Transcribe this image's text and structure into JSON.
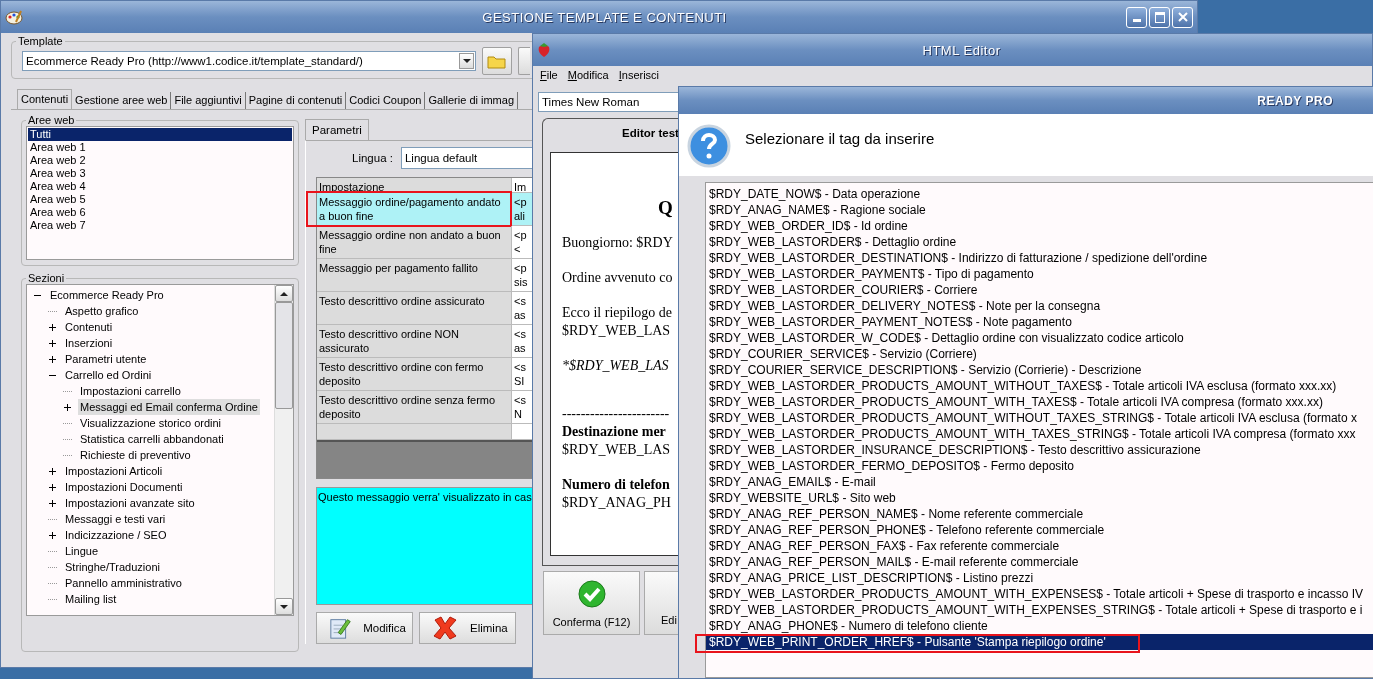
{
  "main_window": {
    "title": "GESTIONE TEMPLATE E CONTENUTI",
    "template": {
      "label": "Template",
      "value": "Ecommerce Ready Pro (http://www1.codice.it/template_standard/)"
    },
    "tabs": [
      {
        "label": "Contenuti",
        "selected": true
      },
      {
        "label": "Gestione aree web",
        "selected": false
      },
      {
        "label": "File aggiuntivi",
        "selected": false
      },
      {
        "label": "Pagine di contenuti",
        "selected": false
      },
      {
        "label": "Codici Coupon",
        "selected": false
      },
      {
        "label": "Gallerie di immag",
        "selected": false
      }
    ],
    "web_areas": {
      "label": "Aree web",
      "items": [
        {
          "label": "Tutti",
          "selected": true
        },
        {
          "label": "Area web 1",
          "selected": false
        },
        {
          "label": "Area web 2",
          "selected": false
        },
        {
          "label": "Area web 3",
          "selected": false
        },
        {
          "label": "Area web 4",
          "selected": false
        },
        {
          "label": "Area web 5",
          "selected": false
        },
        {
          "label": "Area web 6",
          "selected": false
        },
        {
          "label": "Area web 7",
          "selected": false
        }
      ]
    },
    "sections": {
      "label": "Sezioni",
      "tree": [
        {
          "label": "Ecommerce Ready Pro",
          "expanded": true,
          "selected": false,
          "children": [
            {
              "label": "Aspetto grafico",
              "selected": false
            },
            {
              "label": "Contenuti",
              "expanded": false,
              "selected": false
            },
            {
              "label": "Inserzioni",
              "expanded": false,
              "selected": false
            },
            {
              "label": "Parametri utente",
              "expanded": false,
              "selected": false
            },
            {
              "label": "Carrello ed Ordini",
              "expanded": true,
              "selected": false,
              "children": [
                {
                  "label": "Impostazioni carrello",
                  "selected": false
                },
                {
                  "label": "Messaggi ed Email conferma Ordine",
                  "expanded": false,
                  "selected": true
                },
                {
                  "label": "Visualizzazione storico ordini",
                  "selected": false
                },
                {
                  "label": "Statistica carrelli abbandonati",
                  "selected": false
                },
                {
                  "label": "Richieste di preventivo",
                  "selected": false
                }
              ]
            },
            {
              "label": "Impostazioni Articoli",
              "expanded": false,
              "selected": false
            },
            {
              "label": "Impostazioni Documenti",
              "expanded": false,
              "selected": false
            },
            {
              "label": "Impostazioni avanzate sito",
              "expanded": false,
              "selected": false
            },
            {
              "label": "Messaggi e testi vari",
              "selected": false
            },
            {
              "label": "Indicizzazione / SEO",
              "expanded": false,
              "selected": false
            },
            {
              "label": "Lingue",
              "selected": false
            },
            {
              "label": "Stringhe/Traduzioni",
              "selected": false
            },
            {
              "label": "Pannello amministrativo",
              "selected": false
            },
            {
              "label": "Mailing list",
              "selected": false
            }
          ]
        }
      ]
    },
    "parameters": {
      "tab": "Parametri",
      "language_label": "Lingua :",
      "language_value": "Lingua default",
      "columns": [
        "Impostazione",
        "Im"
      ],
      "rows": [
        {
          "setting": "Messaggio ordine/pagamento andato a buon fine",
          "value": [
            "<p",
            "ali"
          ],
          "selected": true
        },
        {
          "setting": "Messaggio ordine non andato a buon fine",
          "value": [
            "<p",
            "<"
          ],
          "selected": false
        },
        {
          "setting": "Messaggio per pagamento fallito",
          "value": [
            "<p",
            "sis"
          ],
          "selected": false
        },
        {
          "setting": "Testo descrittivo ordine assicurato",
          "value": [
            "<s",
            "as"
          ],
          "selected": false
        },
        {
          "setting": "Testo descrittivo ordine NON assicurato",
          "value": [
            "<s",
            "as"
          ],
          "selected": false
        },
        {
          "setting": "Testo descrittivo ordine con fermo deposito",
          "value": [
            "<s",
            "SI"
          ],
          "selected": false
        },
        {
          "setting": "Testo descrittivo ordine senza fermo deposito",
          "value": [
            "<s",
            "N"
          ],
          "selected": false
        }
      ],
      "description": "Questo messaggio verra' visualizzato in cas",
      "buttons": [
        {
          "label": "Modifica",
          "kind": "edit"
        },
        {
          "label": "Elimina",
          "kind": "delete"
        }
      ]
    }
  },
  "html_editor": {
    "title": "HTML Editor",
    "menu": [
      "File",
      "Modifica",
      "Inserisci"
    ],
    "font": "Times New Roman",
    "panel_title": "Editor test",
    "document": [
      [
        {
          "kind": "heading",
          "text": "Q"
        }
      ],
      [
        {
          "kind": "plain",
          "text": "Buongiorno: $RDY"
        }
      ],
      [
        {
          "kind": "plain",
          "text": "Ordine avvenuto co"
        }
      ],
      [
        {
          "kind": "plain",
          "text": "Ecco il riepilogo de"
        },
        {
          "kind": "plain",
          "text": "$RDY_WEB_LAS"
        }
      ],
      [
        {
          "kind": "italic",
          "text": "*$RDY_WEB_LAS"
        }
      ],
      [
        {
          "kind": "rule",
          "text": "-----------------------"
        },
        {
          "kind": "bold",
          "text": "Destinazione mer"
        },
        {
          "kind": "plain",
          "text": "$RDY_WEB_LAS"
        }
      ],
      [
        {
          "kind": "bold",
          "text": "Numero di telefon"
        },
        {
          "kind": "plain",
          "text": "$RDY_ANAG_PH"
        }
      ]
    ],
    "buttons": [
      {
        "label": "Conferma (F12)",
        "kind": "confirm"
      },
      {
        "label": "Edi",
        "kind": "plain"
      }
    ]
  },
  "dialog": {
    "title": "READY PRO",
    "prompt": "Selezionare il tag da inserire",
    "tags": [
      {
        "text": "$RDY_DATE_NOW$ - Data operazione",
        "selected": false
      },
      {
        "text": "$RDY_ANAG_NAME$ - Ragione sociale",
        "selected": false
      },
      {
        "text": "$RDY_WEB_ORDER_ID$ - Id ordine",
        "selected": false
      },
      {
        "text": "$RDY_WEB_LASTORDER$ - Dettaglio ordine",
        "selected": false
      },
      {
        "text": "$RDY_WEB_LASTORDER_DESTINATION$ - Indirizzo di fatturazione / spedizione dell'ordine",
        "selected": false
      },
      {
        "text": "$RDY_WEB_LASTORDER_PAYMENT$ - Tipo di pagamento",
        "selected": false
      },
      {
        "text": "$RDY_WEB_LASTORDER_COURIER$ - Corriere",
        "selected": false
      },
      {
        "text": "$RDY_WEB_LASTORDER_DELIVERY_NOTES$ - Note per la consegna",
        "selected": false
      },
      {
        "text": "$RDY_WEB_LASTORDER_PAYMENT_NOTES$ - Note pagamento",
        "selected": false
      },
      {
        "text": "$RDY_WEB_LASTORDER_W_CODE$ - Dettaglio ordine con visualizzato codice articolo",
        "selected": false
      },
      {
        "text": "$RDY_COURIER_SERVICE$ - Servizio (Corriere)",
        "selected": false
      },
      {
        "text": "$RDY_COURIER_SERVICE_DESCRIPTION$ - Servizio (Corrierie) - Descrizione",
        "selected": false
      },
      {
        "text": "$RDY_WEB_LASTORDER_PRODUCTS_AMOUNT_WITHOUT_TAXES$ - Totale articoli IVA esclusa (formato xxx.xx)",
        "selected": false
      },
      {
        "text": "$RDY_WEB_LASTORDER_PRODUCTS_AMOUNT_WITH_TAXES$ - Totale articoli IVA compresa (formato xxx.xx)",
        "selected": false
      },
      {
        "text": "$RDY_WEB_LASTORDER_PRODUCTS_AMOUNT_WITHOUT_TAXES_STRING$ - Totale articoli IVA esclusa (formato x",
        "selected": false
      },
      {
        "text": "$RDY_WEB_LASTORDER_PRODUCTS_AMOUNT_WITH_TAXES_STRING$ - Totale articoli IVA compresa (formato xxx",
        "selected": false
      },
      {
        "text": "$RDY_WEB_LASTORDER_INSURANCE_DESCRIPTION$ - Testo descrittivo assicurazione",
        "selected": false
      },
      {
        "text": "$RDY_WEB_LASTORDER_FERMO_DEPOSITO$ - Fermo deposito",
        "selected": false
      },
      {
        "text": "$RDY_ANAG_EMAIL$ - E-mail",
        "selected": false
      },
      {
        "text": "$RDY_WEBSITE_URL$ - Sito web",
        "selected": false
      },
      {
        "text": "$RDY_ANAG_REF_PERSON_NAME$ - Nome referente commerciale",
        "selected": false
      },
      {
        "text": "$RDY_ANAG_REF_PERSON_PHONE$ - Telefono referente commerciale",
        "selected": false
      },
      {
        "text": "$RDY_ANAG_REF_PERSON_FAX$ - Fax referente commerciale",
        "selected": false
      },
      {
        "text": "$RDY_ANAG_REF_PERSON_MAIL$ - E-mail referente commerciale",
        "selected": false
      },
      {
        "text": "$RDY_ANAG_PRICE_LIST_DESCRIPTION$ - Listino prezzi",
        "selected": false
      },
      {
        "text": "$RDY_WEB_LASTORDER_PRODUCTS_AMOUNT_WITH_EXPENSES$ - Totale articoli + Spese di trasporto e incasso IV",
        "selected": false
      },
      {
        "text": "$RDY_WEB_LASTORDER_PRODUCTS_AMOUNT_WITH_EXPENSES_STRING$ - Totale articoli + Spese di trasporto e i",
        "selected": false
      },
      {
        "text": "$RDY_ANAG_PHONE$ - Numero di telefono cliente",
        "selected": false
      },
      {
        "text": "$RDY_WEB_PRINT_ORDER_HREF$ - Pulsante 'Stampa riepilogo ordine'",
        "selected": true
      }
    ]
  }
}
